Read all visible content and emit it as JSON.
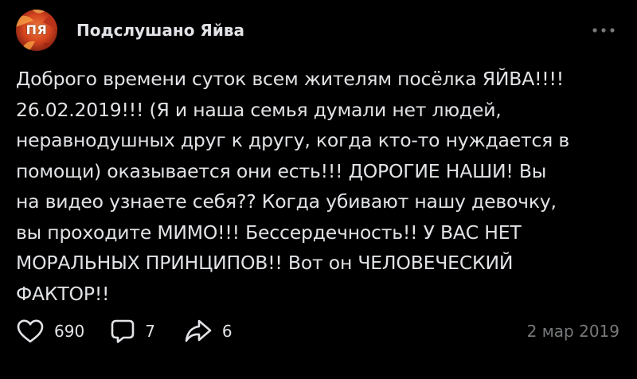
{
  "colors": {
    "background": "#000000",
    "text_primary": "#e1e3e6",
    "text_secondary": "#76787a",
    "avatar_accent": "#e0522b"
  },
  "community": {
    "avatar_text": "ПЯ",
    "name": "Подслушано Яйва"
  },
  "header": {
    "more_icon": "more-horizontal-icon"
  },
  "post": {
    "text": "Доброго времени суток всем жителям посёлка ЯЙВА!!!!\n26.02.2019!!! (Я и наша семья думали нет людей,\nнеравнодушных друг к другу, когда кто-то нуждается в\nпомощи) оказывается они есть!!! ДОРОГИЕ НАШИ! Вы\nна видео узнаете себя?? Когда убивают нашу девочку,\nвы проходите МИМО!!! Бессердечность!! У ВАС НЕТ\nМОРАЛЬНЫХ ПРИНЦИПОВ!! Вот он ЧЕЛОВЕЧЕСКИЙ\nФАКТОР!!"
  },
  "footer": {
    "likes": "690",
    "comments": "7",
    "shares": "6",
    "date": "2 мар 2019",
    "icons": {
      "like": "heart-icon",
      "comment": "comment-icon",
      "share": "share-icon"
    }
  }
}
